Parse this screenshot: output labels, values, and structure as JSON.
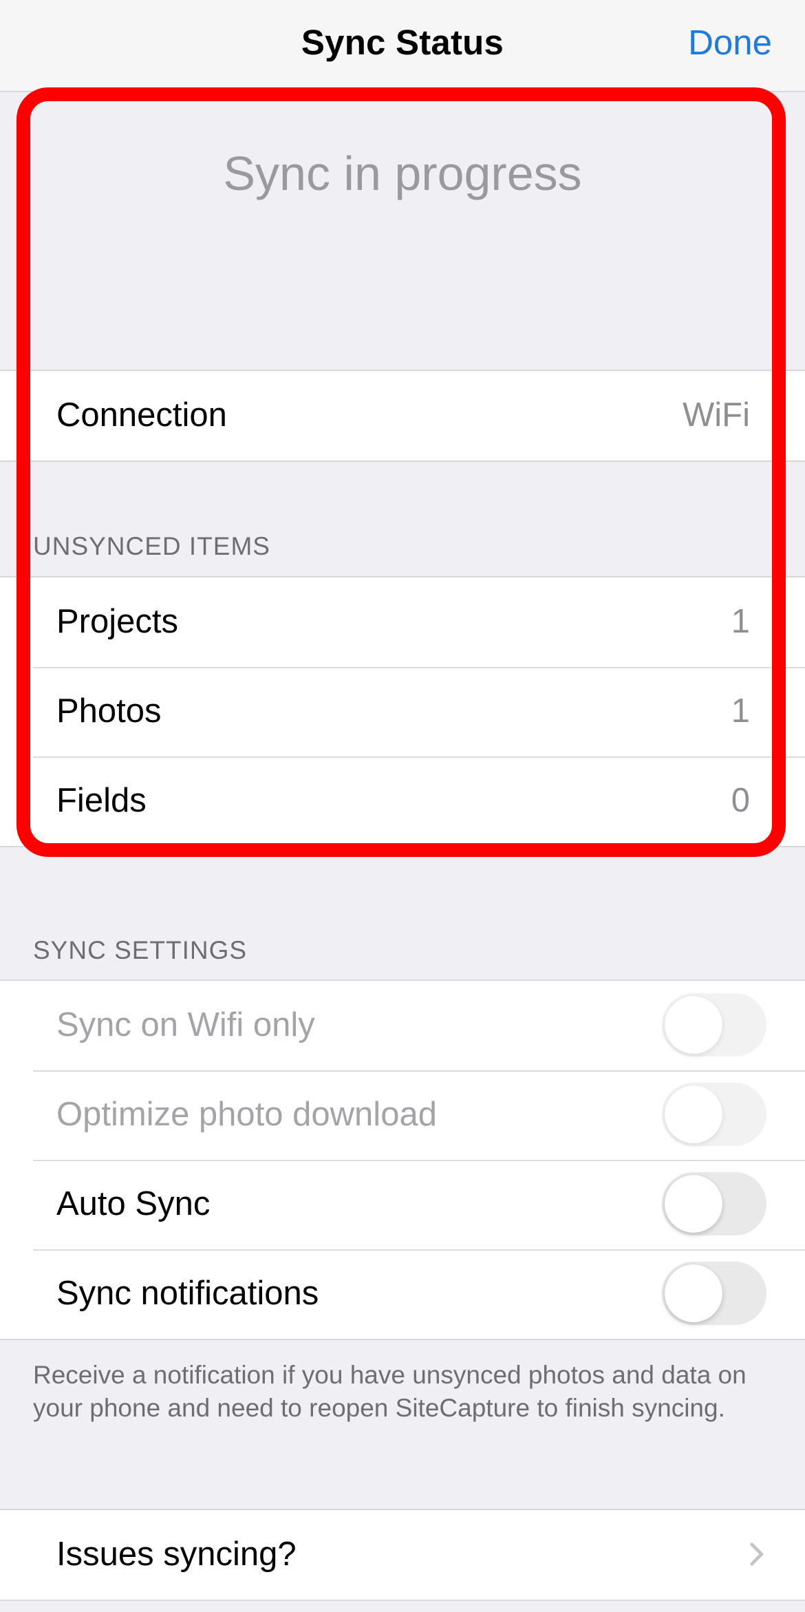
{
  "navbar": {
    "title": "Sync Status",
    "done_label": "Done"
  },
  "status": {
    "title": "Sync in progress"
  },
  "connection": {
    "label": "Connection",
    "value": "WiFi"
  },
  "unsynced": {
    "header": "UNSYNCED ITEMS",
    "rows": [
      {
        "label": "Projects",
        "value": "1"
      },
      {
        "label": "Photos",
        "value": "1"
      },
      {
        "label": "Fields",
        "value": "0"
      }
    ]
  },
  "sync_settings": {
    "header": "SYNC SETTINGS",
    "rows": [
      {
        "label": "Sync on Wifi only",
        "enabled": false,
        "on": false
      },
      {
        "label": "Optimize photo download",
        "enabled": false,
        "on": false
      },
      {
        "label": "Auto Sync",
        "enabled": true,
        "on": false
      },
      {
        "label": "Sync notifications",
        "enabled": true,
        "on": false
      }
    ],
    "footer": "Receive a notification if you have unsynced photos and data on your phone and need to reopen SiteCapture to finish syncing."
  },
  "issues": {
    "label": "Issues syncing?"
  },
  "colors": {
    "accent": "#1f7ae0",
    "highlight": "#ff0000",
    "background": "#efeff4"
  },
  "icons": {
    "issues_row": "chevron-right-icon"
  }
}
